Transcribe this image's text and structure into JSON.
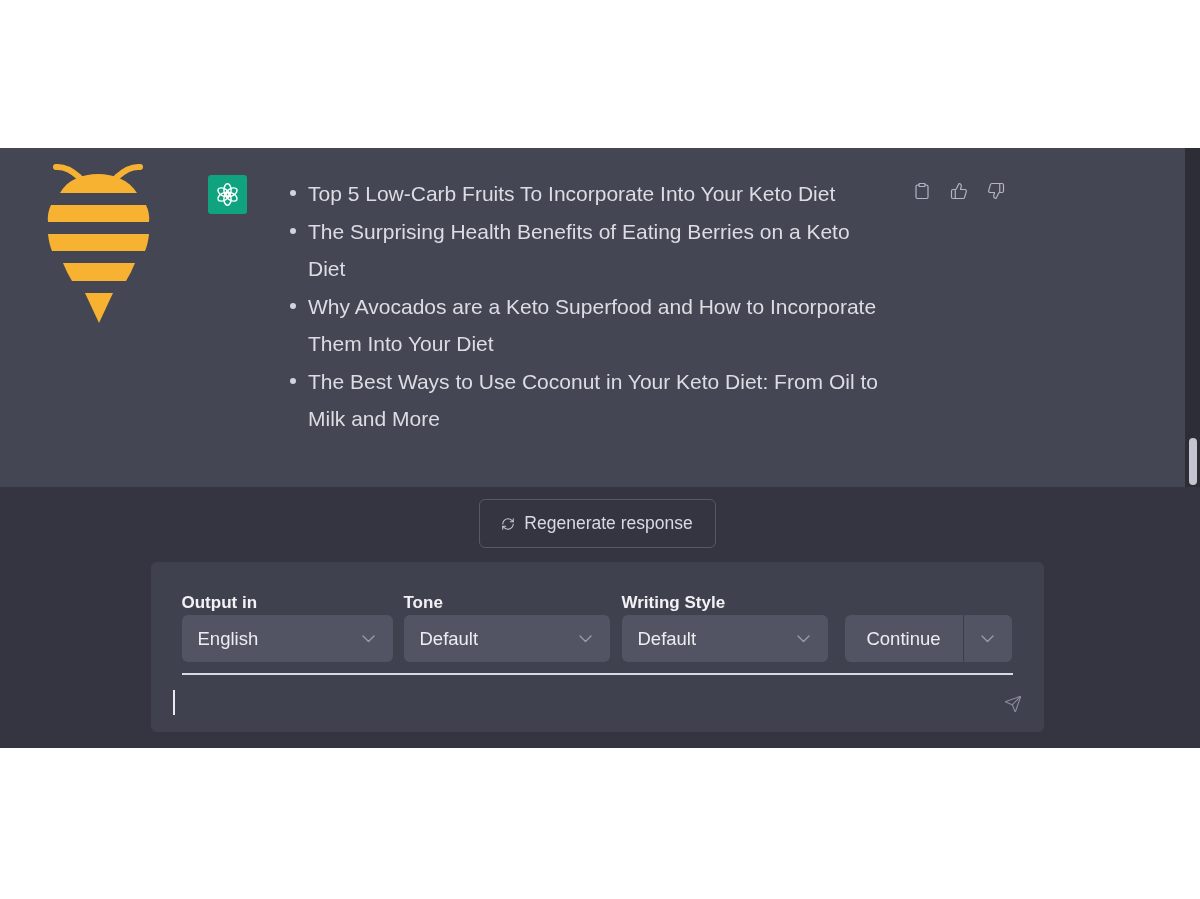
{
  "conversation": {
    "response": {
      "items": [
        "Top 5 Low-Carb Fruits To Incorporate Into Your Keto Diet",
        "The Surprising Health Benefits of Eating Berries on a Keto Diet",
        "Why Avocados are a Keto Superfood and How to Incorporate Them Into Your Diet",
        "The Best Ways to Use Coconut in Your Keto Diet: From Oil to Milk and More"
      ]
    }
  },
  "regenerate_button": {
    "label": "Regenerate response"
  },
  "prompt_panel": {
    "options": [
      {
        "label": "Output in",
        "value": "English"
      },
      {
        "label": "Tone",
        "value": "Default"
      },
      {
        "label": "Writing Style",
        "value": "Default"
      }
    ],
    "continue_button": {
      "label": "Continue"
    }
  }
}
